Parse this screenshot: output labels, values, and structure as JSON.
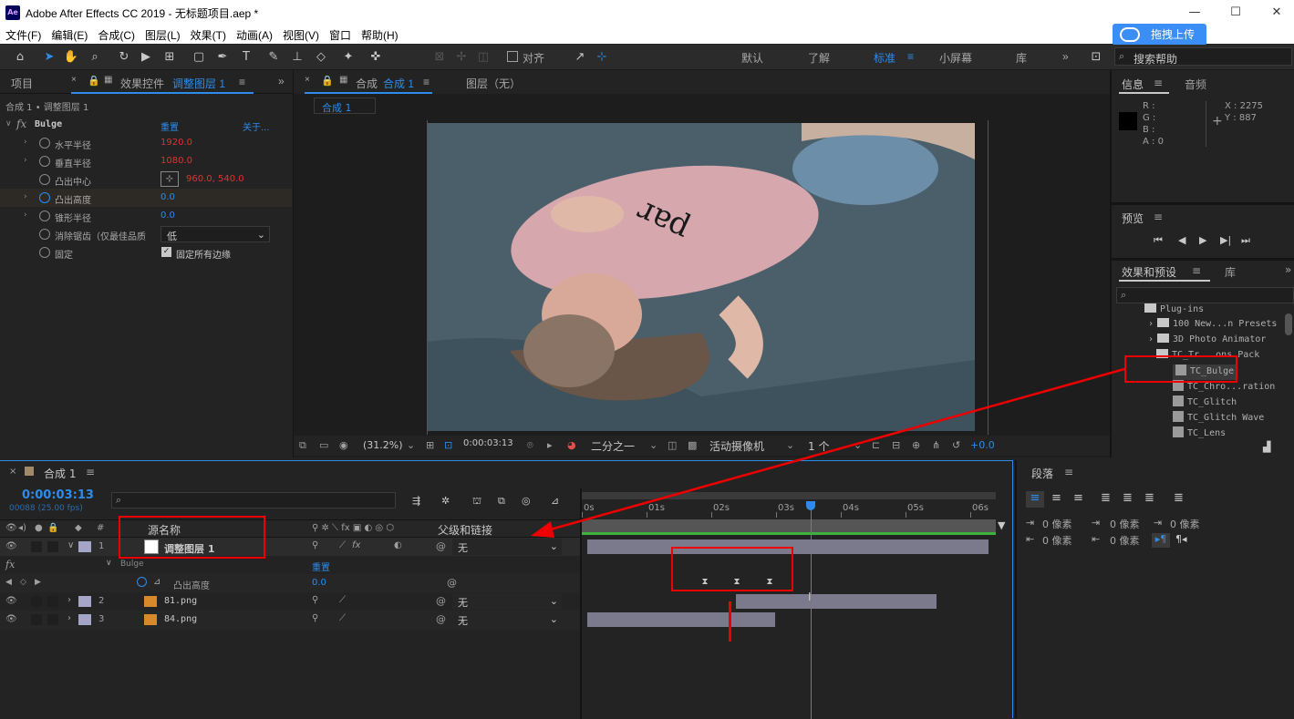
{
  "window": {
    "title": "Adobe After Effects CC 2019 - 无标题项目.aep *",
    "app_icon": "Ae"
  },
  "menu": [
    "文件(F)",
    "编辑(E)",
    "合成(C)",
    "图层(L)",
    "效果(T)",
    "动画(A)",
    "视图(V)",
    "窗口",
    "帮助(H)"
  ],
  "upload_button": "拖拽上传",
  "toolbar": {
    "align_label": "对齐",
    "workspaces": [
      "默认",
      "了解",
      "标准",
      "小屏幕",
      "库"
    ],
    "active_workspace": "标准",
    "search_help": "搜索帮助"
  },
  "left_panel": {
    "tab_project": "项目",
    "tab_effects": "效果控件",
    "tab_effects_layer": "调整图层 1",
    "breadcrumb": "合成 1 • 调整图层 1",
    "effect_name": "Bulge",
    "reset": "重置",
    "about": "关于...",
    "props": [
      {
        "label": "水平半径",
        "value": "1920.0"
      },
      {
        "label": "垂直半径",
        "value": "1080.0"
      },
      {
        "label": "凸出中心",
        "value": "960.0, 540.0"
      },
      {
        "label": "凸出高度",
        "value": "0.0"
      },
      {
        "label": "锥形半径",
        "value": "0.0"
      },
      {
        "label": "消除锯齿（仅最佳品质",
        "value": "低"
      },
      {
        "label": "固定",
        "value": "固定所有边缘"
      }
    ]
  },
  "viewer": {
    "tab_comp": "合成",
    "tab_comp_name": "合成 1",
    "tab_layer": "图层（无）",
    "comp_chip": "合成 1",
    "zoom": "(31.2%)",
    "timecode": "0:00:03:13",
    "resolution": "二分之一",
    "camera": "活动摄像机",
    "views": "1 个",
    "exposure": "+0.0"
  },
  "info_panel": {
    "tab_info": "信息",
    "tab_audio": "音频",
    "r": "R :",
    "g": "G :",
    "b": "B :",
    "a": "A : 0",
    "x": "X : 2275",
    "y": "Y : 887"
  },
  "preview_panel": {
    "title": "预览"
  },
  "effects_presets": {
    "tab": "效果和预设",
    "tab_lib": "库",
    "items": [
      {
        "label": "Plug-ins",
        "kind": "folder",
        "indent": 0
      },
      {
        "label": "100 New...n Presets",
        "kind": "folder",
        "indent": 1
      },
      {
        "label": "3D Photo Animator",
        "kind": "folder",
        "indent": 1
      },
      {
        "label": "TC_Tr...ons Pack",
        "kind": "folder",
        "indent": 1
      },
      {
        "label": "TC_Bulge",
        "kind": "effect",
        "indent": 2
      },
      {
        "label": "TC_Chro...ration",
        "kind": "effect",
        "indent": 2
      },
      {
        "label": "TC_Glitch",
        "kind": "effect",
        "indent": 2
      },
      {
        "label": "TC_Glitch Wave",
        "kind": "effect",
        "indent": 2
      },
      {
        "label": "TC_Lens",
        "kind": "effect",
        "indent": 2
      }
    ]
  },
  "timeline": {
    "tab": "合成 1",
    "timecode": "0:00:03:13",
    "frames": "00088 (25.00 fps)",
    "col_num": "#",
    "col_source": "源名称",
    "col_parent": "父级和链接",
    "ruler": [
      "0s",
      "01s",
      "02s",
      "03s",
      "04s",
      "05s",
      "06s"
    ],
    "playhead_seconds": 3.52,
    "duration_seconds": 6.4,
    "layers": [
      {
        "num": "1",
        "name": "调整图层 1",
        "parent": "无",
        "color": "#a5a5c8",
        "start": 0,
        "end": 6.2
      },
      {
        "num": "2",
        "name": "81.png",
        "parent": "无",
        "color": "#a5a5c8",
        "start": 2.3,
        "end": 5.4
      },
      {
        "num": "3",
        "name": "84.png",
        "parent": "无",
        "color": "#a5a5c8",
        "start": 0,
        "end": 2.9
      }
    ],
    "effect_row": "Bulge",
    "effect_reset": "重置",
    "prop_row": "凸出高度",
    "prop_value": "0.0",
    "keyframes": [
      1.8,
      2.3,
      2.8
    ]
  },
  "paragraph": {
    "title": "段落",
    "px": "0 像素"
  }
}
